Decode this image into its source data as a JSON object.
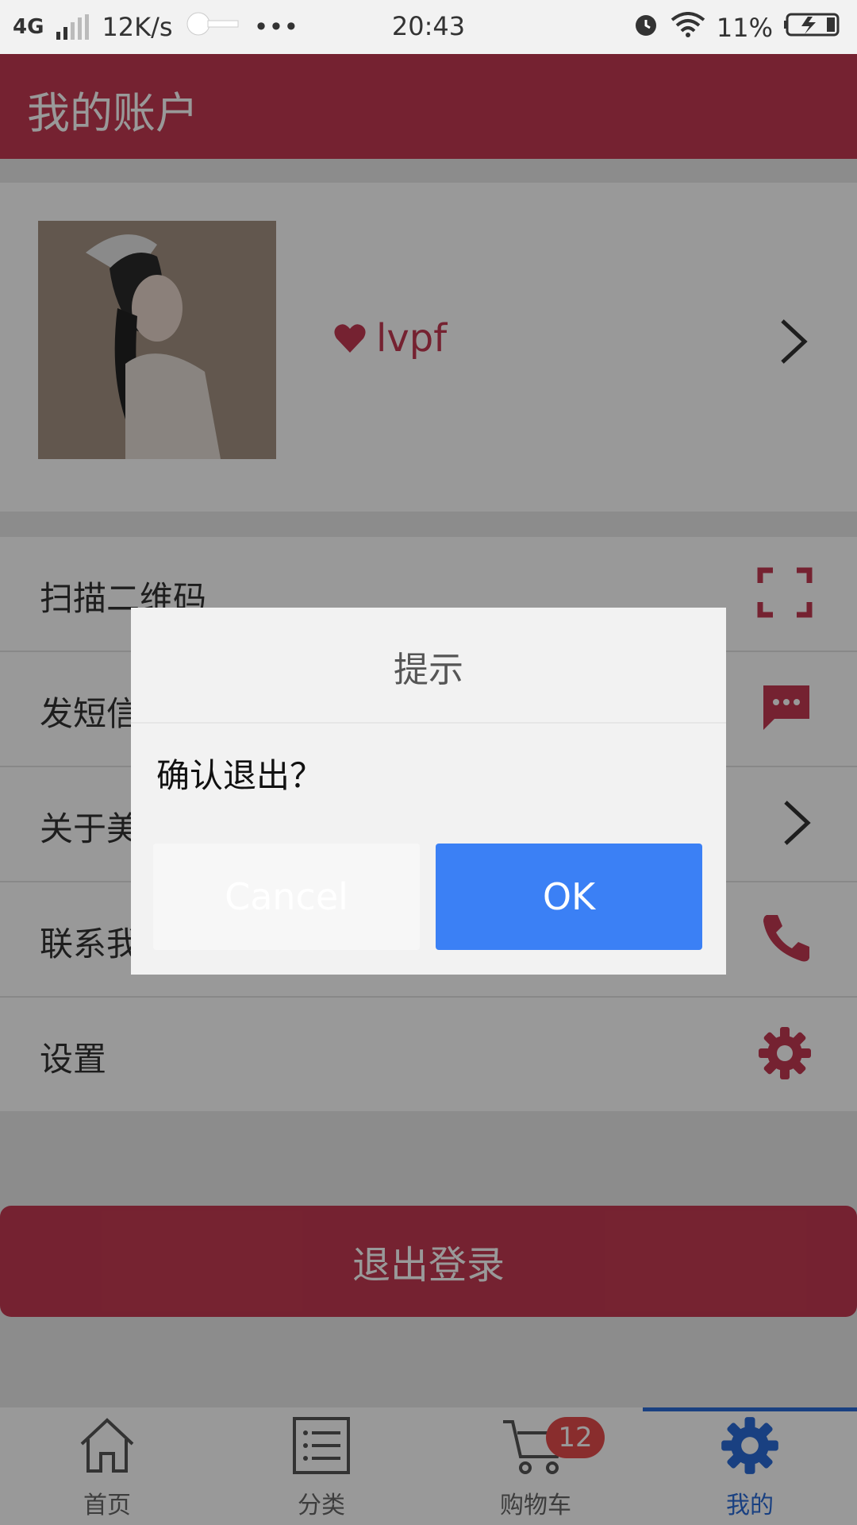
{
  "status_bar": {
    "network": "4G",
    "speed": "12K/s",
    "more": "•••",
    "time": "20:43",
    "battery": "11%"
  },
  "header": {
    "title": "我的账户"
  },
  "profile": {
    "username": "lvpf"
  },
  "menu": {
    "items": [
      {
        "label": "扫描二维码",
        "icon": "scan-icon"
      },
      {
        "label": "发短信",
        "icon": "message-icon"
      },
      {
        "label": "关于美啊",
        "icon": "chevron-right-icon"
      },
      {
        "label": "联系我们",
        "icon": "phone-icon"
      },
      {
        "label": "设置",
        "icon": "gear-icon"
      }
    ]
  },
  "logout": {
    "label": "退出登录"
  },
  "tabbar": {
    "items": [
      {
        "label": "首页",
        "icon": "home-icon"
      },
      {
        "label": "分类",
        "icon": "list-icon"
      },
      {
        "label": "购物车",
        "icon": "cart-icon",
        "badge": "12"
      },
      {
        "label": "我的",
        "icon": "gear-icon",
        "active": true
      }
    ]
  },
  "dialog": {
    "title": "提示",
    "message": "确认退出？",
    "cancel_label": "Cancel",
    "ok_label": "OK"
  },
  "colors": {
    "brand": "#c43a52",
    "active_tab": "#2a6bd8",
    "ok_button": "#3b80f5",
    "badge": "#e54c4c"
  }
}
